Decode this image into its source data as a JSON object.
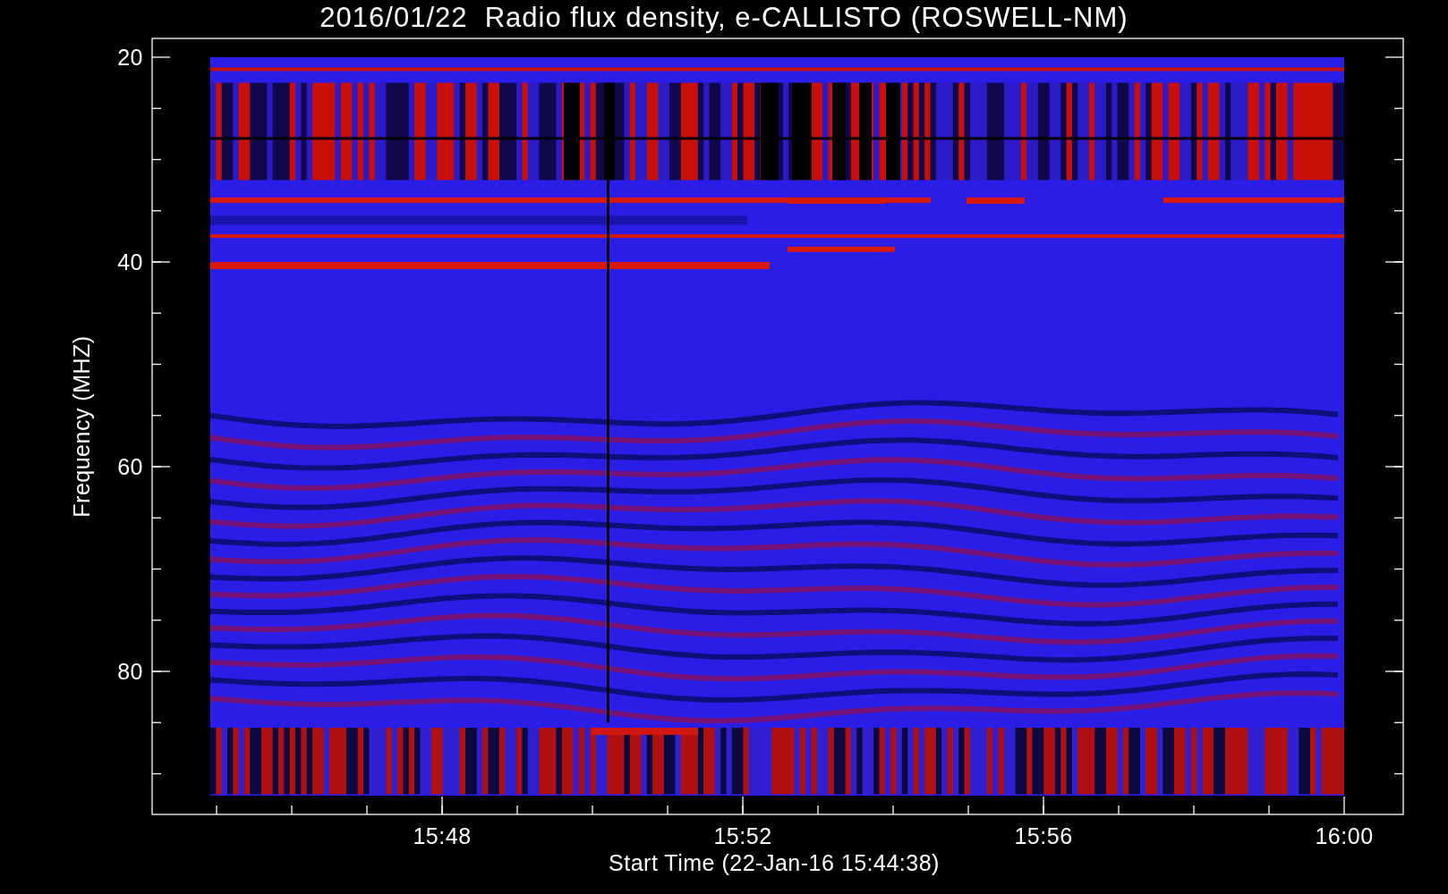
{
  "title": "2016/01/22  Radio flux density, e-CALLISTO (ROSWELL-NM)",
  "xlabel": "Start Time (22-Jan-16 15:44:38)",
  "ylabel": "Frequency (MHZ)",
  "yticks": [
    "20",
    "40",
    "60",
    "80"
  ],
  "xticks": [
    "15:48",
    "15:52",
    "15:56",
    "16:00"
  ]
}
